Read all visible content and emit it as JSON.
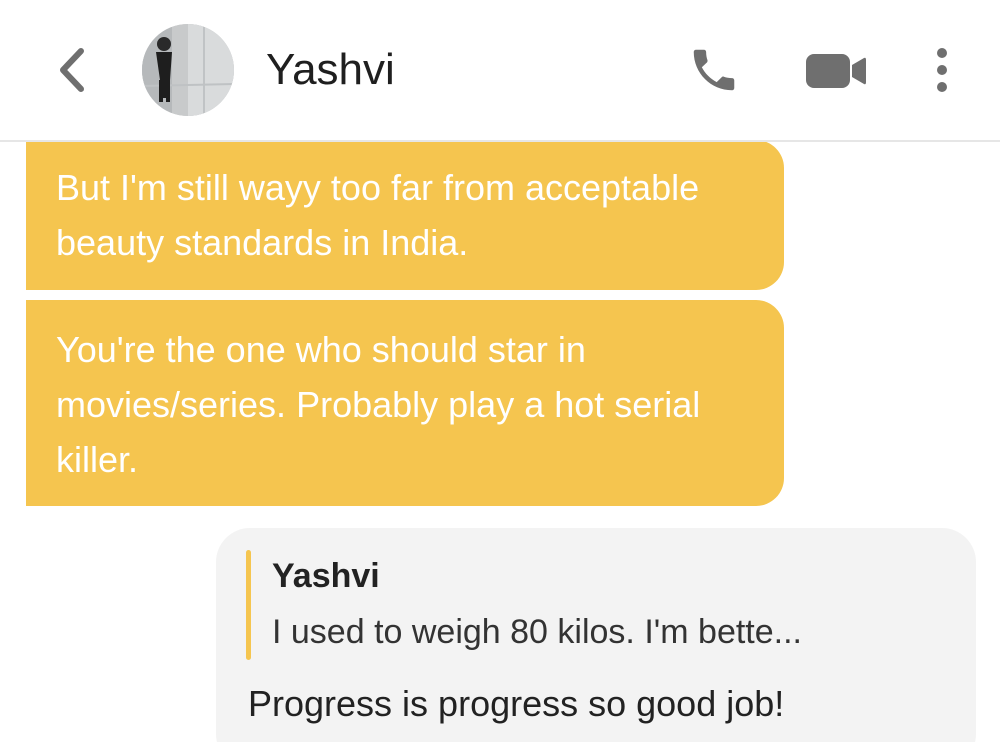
{
  "header": {
    "contact_name": "Yashvi",
    "icons": {
      "back": "chevron-left-icon",
      "avatar": "avatar-photo",
      "call": "phone-icon",
      "video": "video-camera-icon",
      "more": "more-vertical-icon"
    }
  },
  "messages": [
    {
      "direction": "incoming",
      "text": "But I'm still wayy too far from acceptable beauty standards in India."
    },
    {
      "direction": "incoming",
      "text": "You're the one who should star in movies/series. Probably play a hot serial killer."
    },
    {
      "direction": "outgoing",
      "quote": {
        "author": "Yashvi",
        "text": "I used to weigh 80 kilos. I'm bette..."
      },
      "text": "Progress is progress so good job!"
    }
  ],
  "colors": {
    "incoming_bubble": "#f5c54f",
    "outgoing_bubble": "#f3f3f3",
    "icon_gray": "#6f6f6f",
    "quote_bar": "#f5c54f"
  }
}
